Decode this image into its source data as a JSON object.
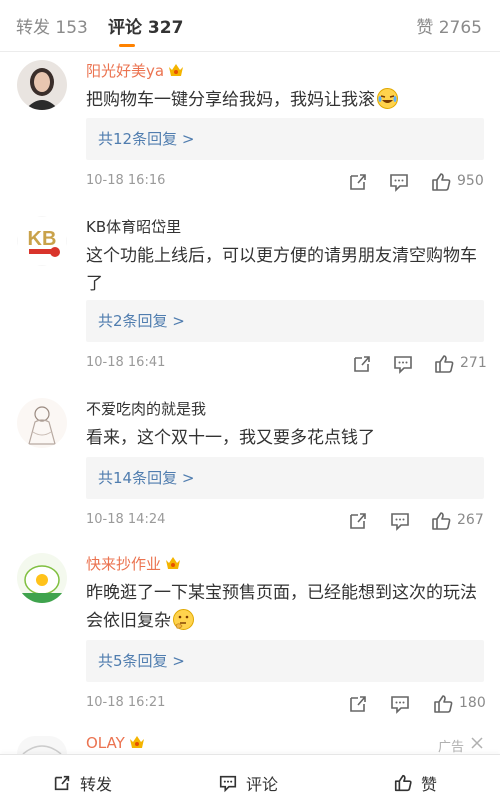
{
  "tabs": {
    "repost": {
      "label": "转发",
      "count": "153"
    },
    "comment": {
      "label": "评论",
      "count": "327"
    },
    "like": {
      "label": "赞",
      "count": "2765"
    }
  },
  "colors": {
    "accent": "#ff8200",
    "link": "#507daf",
    "vip_name": "#eb7350"
  },
  "comments": [
    {
      "user": "阳光好美ya",
      "vip": true,
      "text": "把购物车一键分享给我妈，我妈让我滚",
      "emoji": "laugh-cry-emoji",
      "replies": "共12条回复 >",
      "time": "10-18 16:16",
      "likes": "950"
    },
    {
      "user": "KB体育昭岱里",
      "vip": false,
      "text": "这个功能上线后，可以更方便的请男朋友清空购物车了",
      "replies": "共2条回复 >",
      "time": "10-18 16:41",
      "likes": "271"
    },
    {
      "user": "不爱吃肉的就是我",
      "vip": false,
      "text": "看来，这个双十一，我又要多花点钱了",
      "replies": "共14条回复 >",
      "time": "10-18 14:24",
      "likes": "267"
    },
    {
      "user": "快来抄作业",
      "vip": true,
      "text": "昨晚逛了一下某宝预售页面，已经能想到这次的玩法会依旧复杂",
      "emoji": "thinking-emoji",
      "replies": "共5条回复 >",
      "time": "10-18 16:21",
      "likes": "180"
    }
  ],
  "ad": {
    "user": "OLAY",
    "label": "广告"
  },
  "bottom_bar": {
    "repost": "转发",
    "comment": "评论",
    "like": "赞"
  },
  "icons": [
    "share-icon",
    "comment-icon",
    "like-icon",
    "close-icon",
    "vip-badge-icon"
  ]
}
